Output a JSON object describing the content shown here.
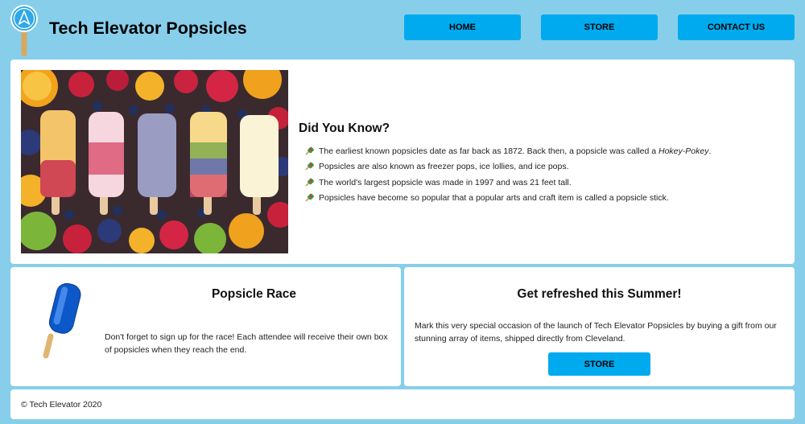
{
  "header": {
    "site_title": "Tech Elevator Popsicles",
    "logo_icon": "popsicle-logo-icon",
    "nav": [
      {
        "label": "HOME"
      },
      {
        "label": "STORE"
      },
      {
        "label": "CONTACT US"
      }
    ]
  },
  "hero": {
    "image": "popsicles-and-fruit-photo",
    "title": "Did You Know?",
    "bullet_icon": "popsicle-bullet-icon",
    "facts": [
      {
        "text": "The earliest known popsicles date as far back as 1872. Back then, a popsicle was called a ",
        "em": "Hokey-Pokey",
        "tail": "."
      },
      {
        "text": "Popsicles are also known as freezer pops, ice lollies, and ice pops.",
        "em": "",
        "tail": ""
      },
      {
        "text": "The world's largest popsicle was made in 1997 and was 21 feet tall.",
        "em": "",
        "tail": ""
      },
      {
        "text": "Popsicles have become so popular that a popular arts and craft item is called a popsicle stick.",
        "em": "",
        "tail": ""
      }
    ]
  },
  "race": {
    "image": "blue-popsicle-icon",
    "title": "Popsicle Race",
    "text": "Don't forget to sign up for the race! Each attendee will receive their own box of popsicles when they reach the end."
  },
  "summer": {
    "title": "Get refreshed this Summer!",
    "text": "Mark this very special occasion of the launch of Tech Elevator Popsicles by buying a gift from our stunning array of items, shipped directly from Cleveland.",
    "button_label": "STORE"
  },
  "footer": {
    "text": "© Tech Elevator 2020"
  },
  "colors": {
    "background": "#87ceeb",
    "button": "#00aaee",
    "card": "#ffffff"
  }
}
